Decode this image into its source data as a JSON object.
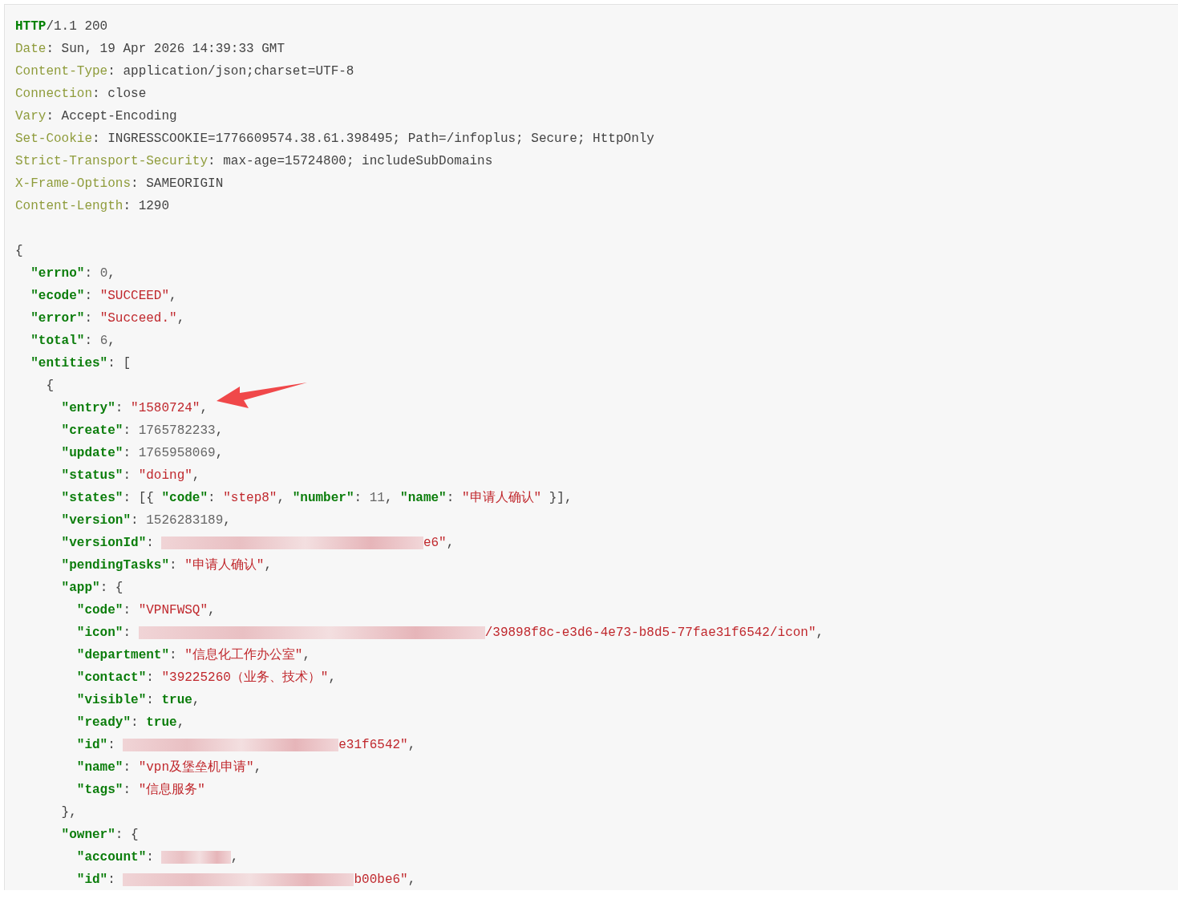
{
  "code_panel": {
    "lines": [
      {
        "tokens": [
          {
            "kind": "proto",
            "text": "HTTP"
          },
          {
            "kind": "text",
            "text": "/1.1 200"
          }
        ]
      },
      {
        "tokens": [
          {
            "kind": "hname",
            "text": "Date"
          },
          {
            "kind": "text",
            "text": ": Sun, 19 Apr 2026 14:39:33 GMT"
          }
        ]
      },
      {
        "tokens": [
          {
            "kind": "hname",
            "text": "Content-Type"
          },
          {
            "kind": "text",
            "text": ": application/json;charset=UTF-8"
          }
        ]
      },
      {
        "tokens": [
          {
            "kind": "hname",
            "text": "Connection"
          },
          {
            "kind": "text",
            "text": ": close"
          }
        ]
      },
      {
        "tokens": [
          {
            "kind": "hname",
            "text": "Vary"
          },
          {
            "kind": "text",
            "text": ": Accept-Encoding"
          }
        ]
      },
      {
        "tokens": [
          {
            "kind": "hname",
            "text": "Set-Cookie"
          },
          {
            "kind": "text",
            "text": ": INGRESSCOOKIE=1776609574.38.61.398495; Path=/infoplus; Secure; HttpOnly"
          }
        ]
      },
      {
        "tokens": [
          {
            "kind": "hname",
            "text": "Strict-Transport-Security"
          },
          {
            "kind": "text",
            "text": ": max-age=15724800; includeSubDomains"
          }
        ]
      },
      {
        "tokens": [
          {
            "kind": "hname",
            "text": "X-Frame-Options"
          },
          {
            "kind": "text",
            "text": ": SAMEORIGIN"
          }
        ]
      },
      {
        "tokens": [
          {
            "kind": "hname",
            "text": "Content-Length"
          },
          {
            "kind": "text",
            "text": ": 1290"
          }
        ]
      },
      {
        "kind": "blank"
      },
      {
        "tokens": [
          {
            "kind": "text",
            "text": "{"
          }
        ]
      },
      {
        "tokens": [
          {
            "kind": "key",
            "text": "  \"errno\""
          },
          {
            "kind": "text",
            "text": ": "
          },
          {
            "kind": "num",
            "text": "0"
          },
          {
            "kind": "text",
            "text": ","
          }
        ]
      },
      {
        "tokens": [
          {
            "kind": "key",
            "text": "  \"ecode\""
          },
          {
            "kind": "text",
            "text": ": "
          },
          {
            "kind": "str",
            "text": "\"SUCCEED\""
          },
          {
            "kind": "text",
            "text": ","
          }
        ]
      },
      {
        "tokens": [
          {
            "kind": "key",
            "text": "  \"error\""
          },
          {
            "kind": "text",
            "text": ": "
          },
          {
            "kind": "str",
            "text": "\"Succeed.\""
          },
          {
            "kind": "text",
            "text": ","
          }
        ]
      },
      {
        "tokens": [
          {
            "kind": "key",
            "text": "  \"total\""
          },
          {
            "kind": "text",
            "text": ": "
          },
          {
            "kind": "num",
            "text": "6"
          },
          {
            "kind": "text",
            "text": ","
          }
        ]
      },
      {
        "tokens": [
          {
            "kind": "key",
            "text": "  \"entities\""
          },
          {
            "kind": "text",
            "text": ": ["
          }
        ]
      },
      {
        "tokens": [
          {
            "kind": "text",
            "text": "    {"
          }
        ]
      },
      {
        "tokens": [
          {
            "kind": "key",
            "text": "      \"entry\""
          },
          {
            "kind": "text",
            "text": ": "
          },
          {
            "kind": "str",
            "text": "\"1580724\""
          },
          {
            "kind": "text",
            "text": ","
          }
        ]
      },
      {
        "tokens": [
          {
            "kind": "key",
            "text": "      \"create\""
          },
          {
            "kind": "text",
            "text": ": "
          },
          {
            "kind": "num",
            "text": "1765782233"
          },
          {
            "kind": "text",
            "text": ","
          }
        ]
      },
      {
        "tokens": [
          {
            "kind": "key",
            "text": "      \"update\""
          },
          {
            "kind": "text",
            "text": ": "
          },
          {
            "kind": "num",
            "text": "1765958069"
          },
          {
            "kind": "text",
            "text": ","
          }
        ]
      },
      {
        "tokens": [
          {
            "kind": "key",
            "text": "      \"status\""
          },
          {
            "kind": "text",
            "text": ": "
          },
          {
            "kind": "str",
            "text": "\"doing\""
          },
          {
            "kind": "text",
            "text": ","
          }
        ]
      },
      {
        "tokens": [
          {
            "kind": "key",
            "text": "      \"states\""
          },
          {
            "kind": "text",
            "text": ": [{ "
          },
          {
            "kind": "key",
            "text": "\"code\""
          },
          {
            "kind": "text",
            "text": ": "
          },
          {
            "kind": "str",
            "text": "\"step8\""
          },
          {
            "kind": "text",
            "text": ", "
          },
          {
            "kind": "key",
            "text": "\"number\""
          },
          {
            "kind": "text",
            "text": ": "
          },
          {
            "kind": "num",
            "text": "11"
          },
          {
            "kind": "text",
            "text": ", "
          },
          {
            "kind": "key",
            "text": "\"name\""
          },
          {
            "kind": "text",
            "text": ": "
          },
          {
            "kind": "str",
            "text": "\"申请人确认\""
          },
          {
            "kind": "text",
            "text": " }],"
          }
        ]
      },
      {
        "tokens": [
          {
            "kind": "key",
            "text": "      \"version\""
          },
          {
            "kind": "text",
            "text": ": "
          },
          {
            "kind": "num",
            "text": "1526283189"
          },
          {
            "kind": "text",
            "text": ","
          }
        ]
      },
      {
        "tokens": [
          {
            "kind": "key",
            "text": "      \"versionId\""
          },
          {
            "kind": "text",
            "text": ": "
          },
          {
            "kind": "redacted"
          },
          {
            "kind": "str",
            "text": "e6\""
          },
          {
            "kind": "text",
            "text": ","
          }
        ]
      },
      {
        "tokens": [
          {
            "kind": "key",
            "text": "      \"pendingTasks\""
          },
          {
            "kind": "text",
            "text": ": "
          },
          {
            "kind": "str",
            "text": "\"申请人确认\""
          },
          {
            "kind": "text",
            "text": ","
          }
        ]
      },
      {
        "tokens": [
          {
            "kind": "key",
            "text": "      \"app\""
          },
          {
            "kind": "text",
            "text": ": {"
          }
        ]
      },
      {
        "tokens": [
          {
            "kind": "key",
            "text": "        \"code\""
          },
          {
            "kind": "text",
            "text": ": "
          },
          {
            "kind": "str",
            "text": "\"VPNFWSQ\""
          },
          {
            "kind": "text",
            "text": ","
          }
        ]
      },
      {
        "tokens": [
          {
            "kind": "key",
            "text": "        \"icon\""
          },
          {
            "kind": "text",
            "text": ": "
          },
          {
            "kind": "redacted"
          },
          {
            "kind": "str",
            "text": "/39898f8c-e3d6-4e73-b8d5-77fae31f6542/icon\""
          },
          {
            "kind": "text",
            "text": ","
          }
        ]
      },
      {
        "tokens": [
          {
            "kind": "key",
            "text": "        \"department\""
          },
          {
            "kind": "text",
            "text": ": "
          },
          {
            "kind": "str",
            "text": "\"信息化工作办公室\""
          },
          {
            "kind": "text",
            "text": ","
          }
        ]
      },
      {
        "tokens": [
          {
            "kind": "key",
            "text": "        \"contact\""
          },
          {
            "kind": "text",
            "text": ": "
          },
          {
            "kind": "str",
            "text": "\"39225260（业务、技术）\""
          },
          {
            "kind": "text",
            "text": ","
          }
        ]
      },
      {
        "tokens": [
          {
            "kind": "key",
            "text": "        \"visible\""
          },
          {
            "kind": "text",
            "text": ": "
          },
          {
            "kind": "bool",
            "text": "true"
          },
          {
            "kind": "text",
            "text": ","
          }
        ]
      },
      {
        "tokens": [
          {
            "kind": "key",
            "text": "        \"ready\""
          },
          {
            "kind": "text",
            "text": ": "
          },
          {
            "kind": "bool",
            "text": "true"
          },
          {
            "kind": "text",
            "text": ","
          }
        ]
      },
      {
        "tokens": [
          {
            "kind": "key",
            "text": "        \"id\""
          },
          {
            "kind": "text",
            "text": ": "
          },
          {
            "kind": "redacted"
          },
          {
            "kind": "str",
            "text": "e31f6542\""
          },
          {
            "kind": "text",
            "text": ","
          }
        ]
      },
      {
        "tokens": [
          {
            "kind": "key",
            "text": "        \"name\""
          },
          {
            "kind": "text",
            "text": ": "
          },
          {
            "kind": "str",
            "text": "\"vpn及堡垒机申请\""
          },
          {
            "kind": "text",
            "text": ","
          }
        ]
      },
      {
        "tokens": [
          {
            "kind": "key",
            "text": "        \"tags\""
          },
          {
            "kind": "text",
            "text": ": "
          },
          {
            "kind": "str",
            "text": "\"信息服务\""
          }
        ]
      },
      {
        "tokens": [
          {
            "kind": "text",
            "text": "      },"
          }
        ]
      },
      {
        "tokens": [
          {
            "kind": "key",
            "text": "      \"owner\""
          },
          {
            "kind": "text",
            "text": ": {"
          }
        ]
      },
      {
        "tokens": [
          {
            "kind": "key",
            "text": "        \"account\""
          },
          {
            "kind": "text",
            "text": ": "
          },
          {
            "kind": "redacted"
          },
          {
            "kind": "text",
            "text": ","
          }
        ]
      },
      {
        "tokens": [
          {
            "kind": "key",
            "text": "        \"id\""
          },
          {
            "kind": "text",
            "text": ": "
          },
          {
            "kind": "redacted"
          },
          {
            "kind": "str",
            "text": "b00be6\""
          },
          {
            "kind": "text",
            "text": ","
          }
        ]
      }
    ]
  }
}
